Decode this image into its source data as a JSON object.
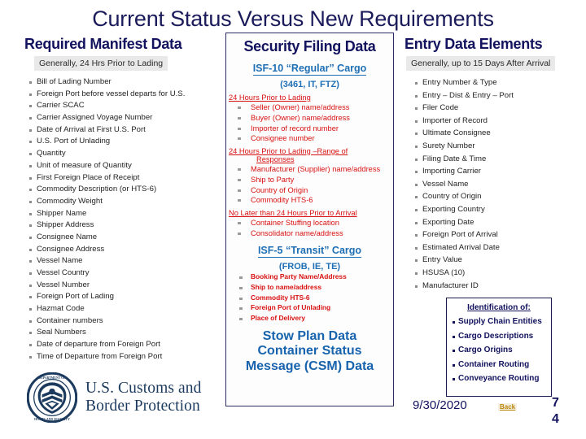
{
  "slide": {
    "title": "Current Status Versus New Requirements"
  },
  "left_column": {
    "heading": "Required Manifest Data",
    "subtitle": "Generally, 24 Hrs Prior to Lading",
    "items": [
      "Bill of Lading Number",
      "Foreign Port before vessel departs for U.S.",
      "Carrier SCAC",
      "Carrier Assigned Voyage Number",
      "Date of Arrival at First U.S. Port",
      "U.S. Port of Unlading",
      "Quantity",
      "Unit of measure of Quantity",
      "First Foreign Place of Receipt",
      "Commodity Description (or HTS-6)",
      "Commodity Weight",
      "Shipper Name",
      "Shipper Address",
      "Consignee Name",
      "Consignee Address",
      "Vessel Name",
      "Vessel Country",
      "Vessel Number",
      "Foreign Port of Lading",
      "Hazmat Code",
      "Container numbers",
      "Seal Numbers",
      "Date of departure from Foreign Port",
      "Time of Departure from Foreign Port"
    ]
  },
  "middle_column": {
    "heading": "Security Filing Data",
    "isf10_title": "ISF-10 “Regular” Cargo",
    "isf10_subtitle": "(3461, IT, FTZ)",
    "group1_heading": "24 Hours Prior to Lading",
    "group1_items": [
      "Seller (Owner) name/address",
      "Buyer (Owner) name/address",
      "Importer of record number",
      "Consignee number"
    ],
    "group2_heading_line1": "24 Hours Prior to Lading –Range of",
    "group2_heading_line2": "Responses",
    "group2_items": [
      "Manufacturer (Supplier) name/address",
      "Ship to Party",
      "Country of Origin",
      "Commodity HTS-6"
    ],
    "group3_heading": "No Later than 24 Hours Prior to Arrival",
    "group3_items": [
      "Container Stuffing location",
      "Consolidator name/address"
    ],
    "isf5_title": "ISF-5 “Transit” Cargo",
    "isf5_subtitle": "(FROB, IE, TE)",
    "isf5_items": [
      "Booking Party Name/Address",
      "Ship to name/address",
      "Commodity HTS-6",
      "Foreign Port of Unlading",
      "Place of Delivery"
    ],
    "stow_line1": "Stow Plan Data",
    "stow_line2": "Container Status",
    "stow_line3": "Message (CSM) Data"
  },
  "right_column": {
    "heading": "Entry Data Elements",
    "subtitle": "Generally, up to 15 Days After Arrival",
    "items": [
      "Entry Number & Type",
      "Entry – Dist & Entry – Port",
      "Filer Code",
      "Importer of Record",
      "Ultimate Consignee",
      "Surety Number",
      "Filing Date & Time",
      "Importing Carrier",
      "Vessel Name",
      "Country of Origin",
      "Exporting Country",
      "Exporting Date",
      "Foreign Port of Arrival",
      "Estimated Arrival Date",
      "Entry Value",
      "HSUSA (10)",
      "Manufacturer ID"
    ]
  },
  "identification_box": {
    "title": "Identification of:",
    "items": [
      "Supply Chain Entities",
      "Cargo Descriptions",
      "Cargo Origins",
      "Container Routing",
      "Conveyance Routing"
    ]
  },
  "footer": {
    "date": "9/30/2020",
    "back_label": "Back",
    "page_number_line1": "7",
    "page_number_line2": "4"
  },
  "logo": {
    "line1": "U.S. Customs and",
    "line2": "Border Protection",
    "seal_alt": "dhs-cbp-seal"
  },
  "colors": {
    "title_navy": "#1b1b5c",
    "heading_navy": "#12125e",
    "isf_blue": "#1f6fb5",
    "red": "#d81111",
    "band_gray": "#e9e9e9",
    "back_gold": "#b8860b"
  }
}
